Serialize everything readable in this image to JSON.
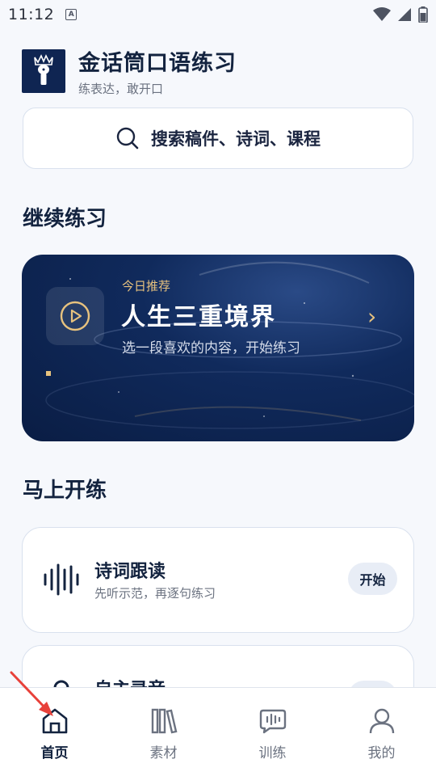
{
  "status_bar": {
    "time": "11:12",
    "notification_icon": "A"
  },
  "app": {
    "title": "金话筒口语练习",
    "subtitle": "练表达，敢开口"
  },
  "search": {
    "placeholder": "搜索稿件、诗词、课程"
  },
  "continue_section": {
    "title": "继续练习",
    "card": {
      "label": "今日推荐",
      "title": "人生三重境界",
      "description": "选一段喜欢的内容，开始练习",
      "progress": 0.01
    }
  },
  "start_section": {
    "title": "马上开练",
    "items": [
      {
        "title": "诗词跟读",
        "description": "先听示范，再逐句练习",
        "button": "开始",
        "icon": "waveform-icon"
      },
      {
        "title": "自主录音",
        "description": "",
        "button": "开始",
        "icon": "microphone-icon"
      }
    ]
  },
  "tabs": [
    {
      "label": "首页",
      "icon": "home-icon",
      "active": true
    },
    {
      "label": "素材",
      "icon": "books-icon",
      "active": false
    },
    {
      "label": "训练",
      "icon": "chat-wave-icon",
      "active": false
    },
    {
      "label": "我的",
      "icon": "user-icon",
      "active": false
    }
  ],
  "colors": {
    "accent": "#0f2552",
    "gold": "#e7c27e",
    "background": "#f6f8fc",
    "annotation": "#e8413a"
  }
}
